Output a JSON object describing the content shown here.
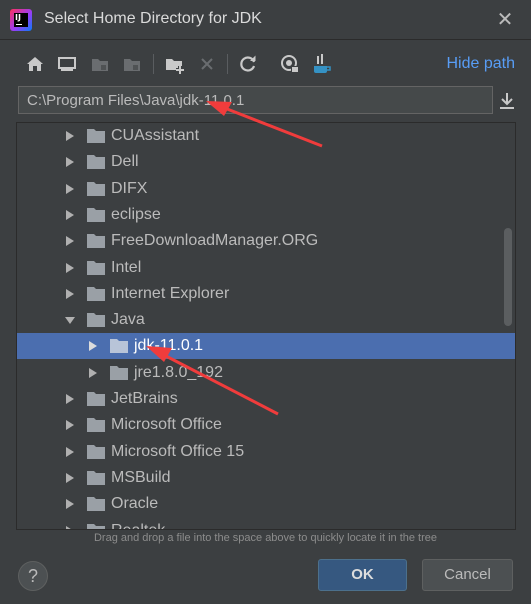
{
  "window": {
    "title": "Select Home Directory for JDK",
    "app_logo_text": "IJ",
    "close_glyph": "✕"
  },
  "toolbar": {
    "icons": [
      "home-icon",
      "desktop-icon",
      "project-icon",
      "module-icon",
      "new-folder-icon",
      "delete-icon",
      "refresh-icon",
      "show-hidden-icon",
      "jdk-icon"
    ],
    "hide_path_label": "Hide path"
  },
  "path": {
    "value": "C:\\Program Files\\Java\\jdk-11.0.1"
  },
  "tree": {
    "items": [
      {
        "label": "CUAssistant",
        "level": 0,
        "expanded": false,
        "selected": false
      },
      {
        "label": "Dell",
        "level": 0,
        "expanded": false,
        "selected": false
      },
      {
        "label": "DIFX",
        "level": 0,
        "expanded": false,
        "selected": false
      },
      {
        "label": "eclipse",
        "level": 0,
        "expanded": false,
        "selected": false
      },
      {
        "label": "FreeDownloadManager.ORG",
        "level": 0,
        "expanded": false,
        "selected": false
      },
      {
        "label": "Intel",
        "level": 0,
        "expanded": false,
        "selected": false
      },
      {
        "label": "Internet Explorer",
        "level": 0,
        "expanded": false,
        "selected": false
      },
      {
        "label": "Java",
        "level": 0,
        "expanded": true,
        "selected": false
      },
      {
        "label": "jdk-11.0.1",
        "level": 1,
        "expanded": false,
        "selected": true
      },
      {
        "label": "jre1.8.0_192",
        "level": 1,
        "expanded": false,
        "selected": false
      },
      {
        "label": "JetBrains",
        "level": 0,
        "expanded": false,
        "selected": false
      },
      {
        "label": "Microsoft Office",
        "level": 0,
        "expanded": false,
        "selected": false
      },
      {
        "label": "Microsoft Office 15",
        "level": 0,
        "expanded": false,
        "selected": false
      },
      {
        "label": "MSBuild",
        "level": 0,
        "expanded": false,
        "selected": false
      },
      {
        "label": "Oracle",
        "level": 0,
        "expanded": false,
        "selected": false
      },
      {
        "label": "Realtek",
        "level": 0,
        "expanded": false,
        "selected": false
      }
    ]
  },
  "hint": "Drag and drop a file into the space above to quickly locate it in the tree",
  "buttons": {
    "help": "?",
    "ok": "OK",
    "cancel": "Cancel"
  },
  "colors": {
    "background": "#3c3f41",
    "selection": "#4b6eaf",
    "link": "#589df6",
    "annotation_arrow": "#f03c3c"
  }
}
